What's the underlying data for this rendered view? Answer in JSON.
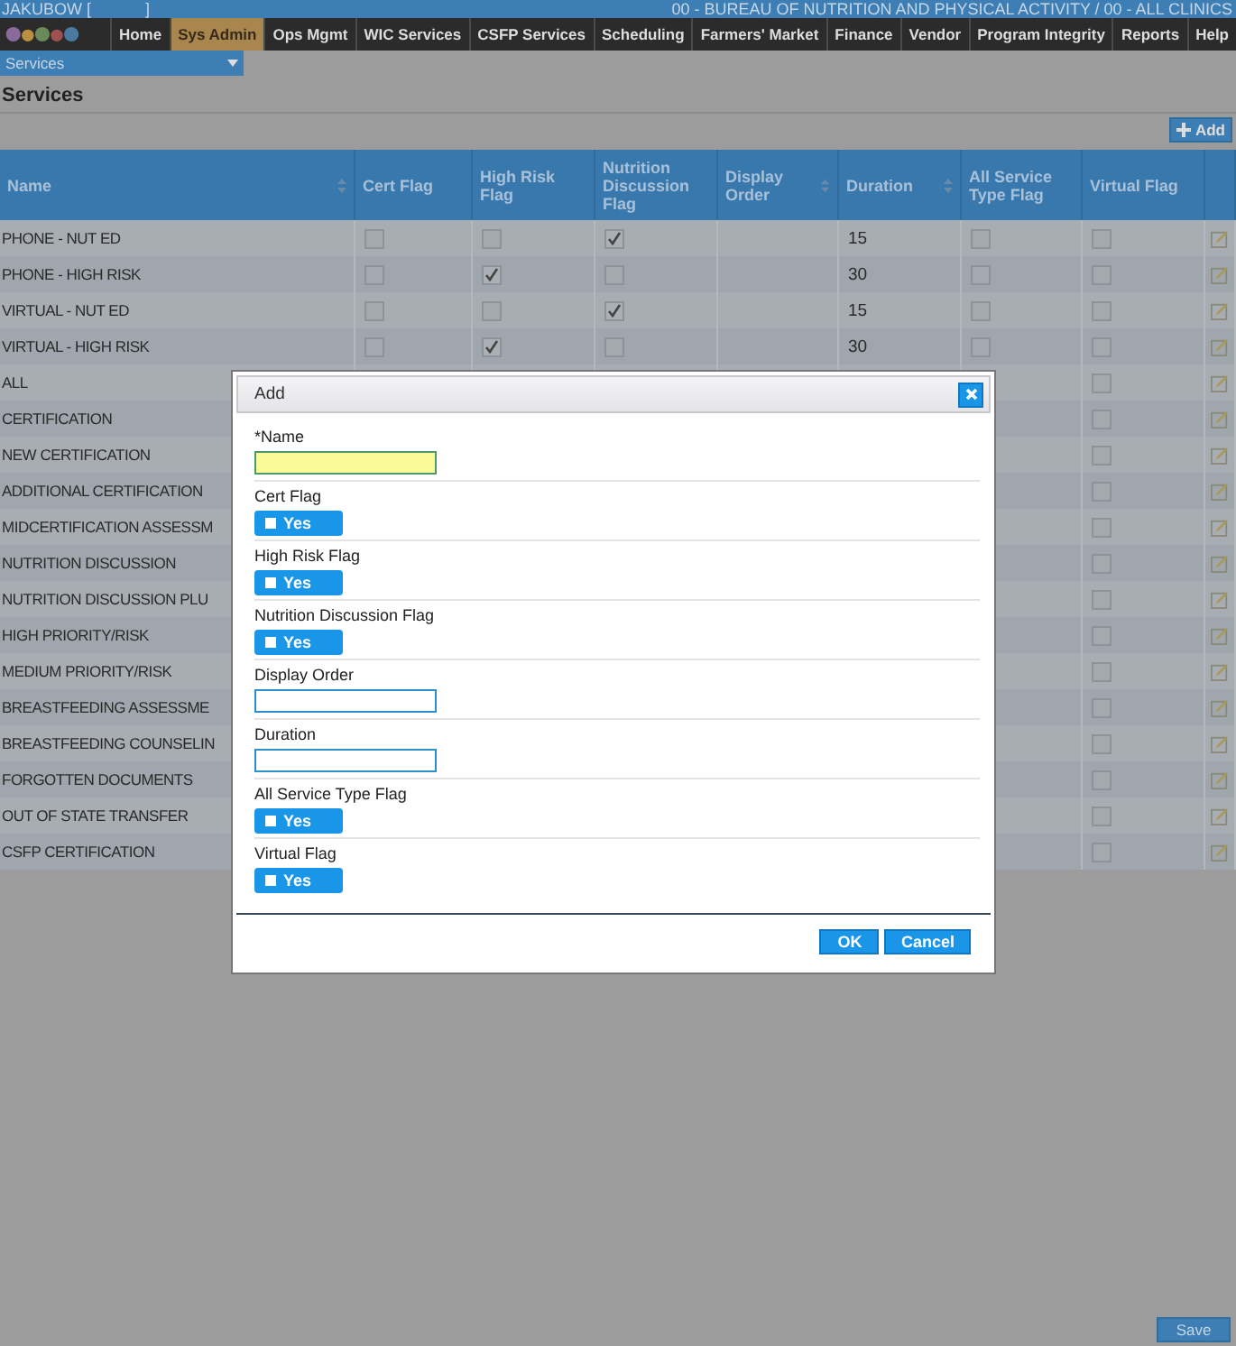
{
  "top_bar": {
    "user": "JAKUBOW [",
    "user_end": "]",
    "clinic": "00 - BUREAU OF NUTRITION AND PHYSICAL ACTIVITY / 00 - ALL CLINICS"
  },
  "nav": [
    {
      "label": "Home",
      "selected": false
    },
    {
      "label": "Sys Admin",
      "selected": true
    },
    {
      "label": "Ops Mgmt",
      "selected": false
    },
    {
      "label": "WIC Services",
      "selected": false
    },
    {
      "label": "CSFP Services",
      "selected": false
    },
    {
      "label": "Scheduling",
      "selected": false
    },
    {
      "label": "Farmers' Market",
      "selected": false
    },
    {
      "label": "Finance",
      "selected": false
    },
    {
      "label": "Vendor",
      "selected": false
    },
    {
      "label": "Program Integrity",
      "selected": false
    },
    {
      "label": "Reports",
      "selected": false
    },
    {
      "label": "Help",
      "selected": false
    }
  ],
  "breadcrumb": {
    "label": "Services"
  },
  "page_title": "Services",
  "add_button": "Add",
  "table": {
    "columns": [
      {
        "label": "Name",
        "sortable": true
      },
      {
        "label": "Cert Flag",
        "sortable": false
      },
      {
        "label": "High Risk Flag",
        "sortable": false
      },
      {
        "label": "Nutrition Discussion Flag",
        "sortable": false
      },
      {
        "label": "Display Order",
        "sortable": true
      },
      {
        "label": "Duration",
        "sortable": true
      },
      {
        "label": "All Service Type Flag",
        "sortable": false
      },
      {
        "label": "Virtual Flag",
        "sortable": false
      }
    ],
    "rows": [
      {
        "name": "PHONE - NUT ED",
        "cert_flag": false,
        "high_risk_flag": false,
        "nutrition_flag": true,
        "duration": "15",
        "all_service_flag": false,
        "virtual_flag": false
      },
      {
        "name": "PHONE - HIGH RISK",
        "cert_flag": false,
        "high_risk_flag": true,
        "nutrition_flag": false,
        "duration": "30",
        "all_service_flag": false,
        "virtual_flag": false
      },
      {
        "name": "VIRTUAL - NUT ED",
        "cert_flag": false,
        "high_risk_flag": false,
        "nutrition_flag": true,
        "duration": "15",
        "all_service_flag": false,
        "virtual_flag": false
      },
      {
        "name": "VIRTUAL - HIGH RISK",
        "cert_flag": false,
        "high_risk_flag": true,
        "nutrition_flag": false,
        "duration": "30",
        "all_service_flag": false,
        "virtual_flag": false
      },
      {
        "name": "ALL",
        "virtual_flag": false
      },
      {
        "name": "CERTIFICATION",
        "virtual_flag": false
      },
      {
        "name": "NEW CERTIFICATION",
        "virtual_flag": false
      },
      {
        "name": "ADDITIONAL CERTIFICATION",
        "virtual_flag": false
      },
      {
        "name": "MIDCERTIFICATION ASSESSM",
        "virtual_flag": false
      },
      {
        "name": "NUTRITION DISCUSSION",
        "virtual_flag": false
      },
      {
        "name": "NUTRITION DISCUSSION PLU",
        "virtual_flag": false
      },
      {
        "name": "HIGH PRIORITY/RISK",
        "virtual_flag": false
      },
      {
        "name": "MEDIUM PRIORITY/RISK",
        "virtual_flag": false
      },
      {
        "name": "BREASTFEEDING ASSESSME",
        "virtual_flag": false
      },
      {
        "name": "BREASTFEEDING COUNSELIN",
        "virtual_flag": false
      },
      {
        "name": "FORGOTTEN DOCUMENTS",
        "virtual_flag": false
      },
      {
        "name": "OUT OF STATE TRANSFER",
        "virtual_flag": false
      },
      {
        "name": "CSFP CERTIFICATION",
        "virtual_flag": false
      }
    ]
  },
  "dialog": {
    "title": "Add",
    "fields": [
      {
        "kind": "required",
        "label": "*Name"
      },
      {
        "kind": "toggle",
        "label": "Cert Flag",
        "text": "Yes",
        "checked": false
      },
      {
        "kind": "toggle",
        "label": "High Risk Flag",
        "text": "Yes",
        "checked": false
      },
      {
        "kind": "toggle",
        "label": "Nutrition Discussion Flag",
        "text": "Yes",
        "checked": false
      },
      {
        "kind": "text",
        "label": "Display Order"
      },
      {
        "kind": "text",
        "label": "Duration"
      },
      {
        "kind": "toggle",
        "label": "All Service Type Flag",
        "text": "Yes",
        "checked": false
      },
      {
        "kind": "toggle",
        "label": "Virtual Flag",
        "text": "Yes",
        "checked": false
      }
    ],
    "buttons": [
      "OK",
      "Cancel"
    ]
  },
  "save_button": "Save"
}
